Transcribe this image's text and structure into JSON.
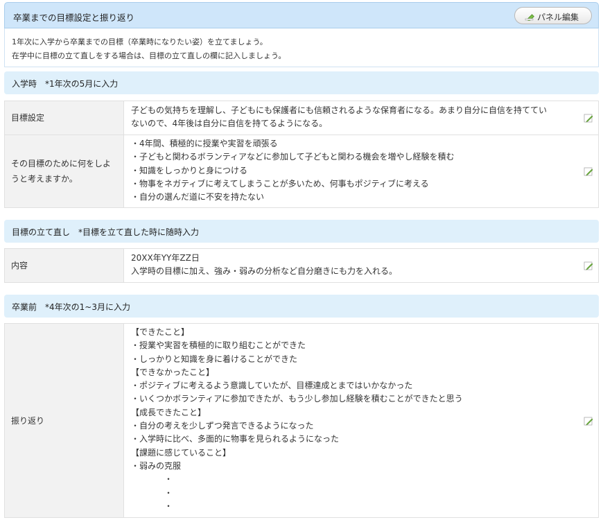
{
  "panel": {
    "title": "卒業までの目標設定と振り返り",
    "edit_button_label": "パネル編集",
    "intro": [
      "1年次に入学から卒業までの目標（卒業時になりたい姿）を立てましょう。",
      "在学中に目標の立て直しをする場合は、目標の立て直しの欄に記入しましょう。"
    ]
  },
  "sections": [
    {
      "title": "入学時　*1年次の5月に入力",
      "rows": [
        {
          "label": "目標設定",
          "lines": [
            "子どもの気持ちを理解し、子どもにも保護者にも信頼されるような保育者になる。あまり自分に自信を持ててい",
            "ないので、4年後は自分に自信を持てるようになる。"
          ]
        },
        {
          "label": "その目標のために何をしようと考えますか。",
          "lines": [
            "・4年間、積極的に授業や実習を頑張る",
            "・子どもと関わるボランティアなどに参加して子どもと関わる機会を増やし経験を積む",
            "・知識をしっかりと身につける",
            "・物事をネガティブに考えてしまうことが多いため、何事もポジティブに考える",
            "・自分の選んだ道に不安を持たない"
          ]
        }
      ]
    },
    {
      "title": "目標の立て直し　*目標を立て直した時に随時入力",
      "rows": [
        {
          "label": "内容",
          "lines": [
            "20XX年YY年ZZ日",
            "入学時の目標に加え、強み・弱みの分析など自分磨きにも力を入れる。"
          ]
        }
      ]
    },
    {
      "title": "卒業前　*4年次の1~3月に入力",
      "rows": [
        {
          "label": "振り返り",
          "lines": [
            "【できたこと】",
            "・授業や実習を積極的に取り組むことができた",
            "・しっかりと知識を身に着けることができた",
            "【できなかったこと】",
            "・ポジティブに考えるよう意識していたが、目標達成とまではいかなかった",
            "・いくつかボランティアに参加できたが、もう少し参加し経験を積むことができたと思う",
            "【成長できたこと】",
            "・自分の考えを少しずつ発言できるようになった",
            "・入学時に比べ、多面的に物事を見られるようになった",
            "【課題に感じていること】",
            "・弱みの克服",
            "　　　　・",
            "　　　　・",
            "　　　　・"
          ]
        }
      ]
    }
  ],
  "icons": {
    "pencil": "pencil-icon",
    "edit": "edit-icon"
  },
  "colors": {
    "panel_header": "#cfe6fa",
    "section_header": "#dff0fb",
    "label_background": "#f2f2f2",
    "pencil_green": "#6cb33f"
  }
}
